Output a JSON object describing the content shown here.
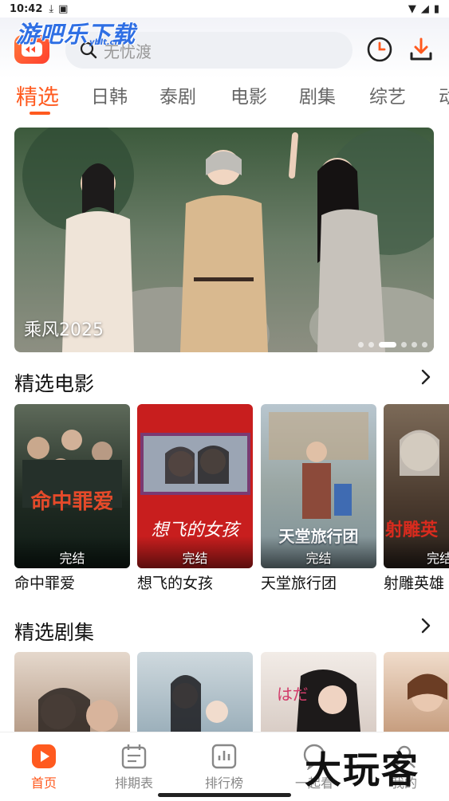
{
  "status_bar": {
    "time": "10:42"
  },
  "header": {
    "watermark": "游吧乐下载",
    "watermark_sub": "yblt.cn",
    "search_placeholder": "无忧渡"
  },
  "tabs": [
    {
      "label": "精选",
      "active": true
    },
    {
      "label": "日韩"
    },
    {
      "label": "泰剧"
    },
    {
      "label": "电影"
    },
    {
      "label": "剧集"
    },
    {
      "label": "综艺"
    },
    {
      "label": "动"
    }
  ],
  "banner": {
    "title": "乘风2025",
    "dot_count": 6,
    "active_dot": 2
  },
  "sections": {
    "movies": {
      "title": "精选电影",
      "items": [
        {
          "title": "命中罪爱",
          "status": "完结",
          "poster_text": "命中罪爱"
        },
        {
          "title": "想飞的女孩",
          "status": "完结",
          "poster_text": "想飞的女孩"
        },
        {
          "title": "天堂旅行团",
          "status": "完结",
          "poster_text": "天堂旅行团"
        },
        {
          "title": "射雕英雄",
          "status": "完结",
          "poster_text": "射雕英"
        }
      ]
    },
    "series": {
      "title": "精选剧集"
    }
  },
  "bottom_nav": [
    {
      "label": "首页",
      "icon": "home-play-icon",
      "active": true
    },
    {
      "label": "排期表",
      "icon": "calendar-icon"
    },
    {
      "label": "排行榜",
      "icon": "ranking-icon"
    },
    {
      "label": "一起看",
      "icon": "watch-together-icon"
    },
    {
      "label": "我的",
      "icon": "profile-icon"
    }
  ],
  "brand_overlay": "大玩客",
  "colors": {
    "accent": "#ff5a1f",
    "search_bg": "#eef0f4"
  }
}
